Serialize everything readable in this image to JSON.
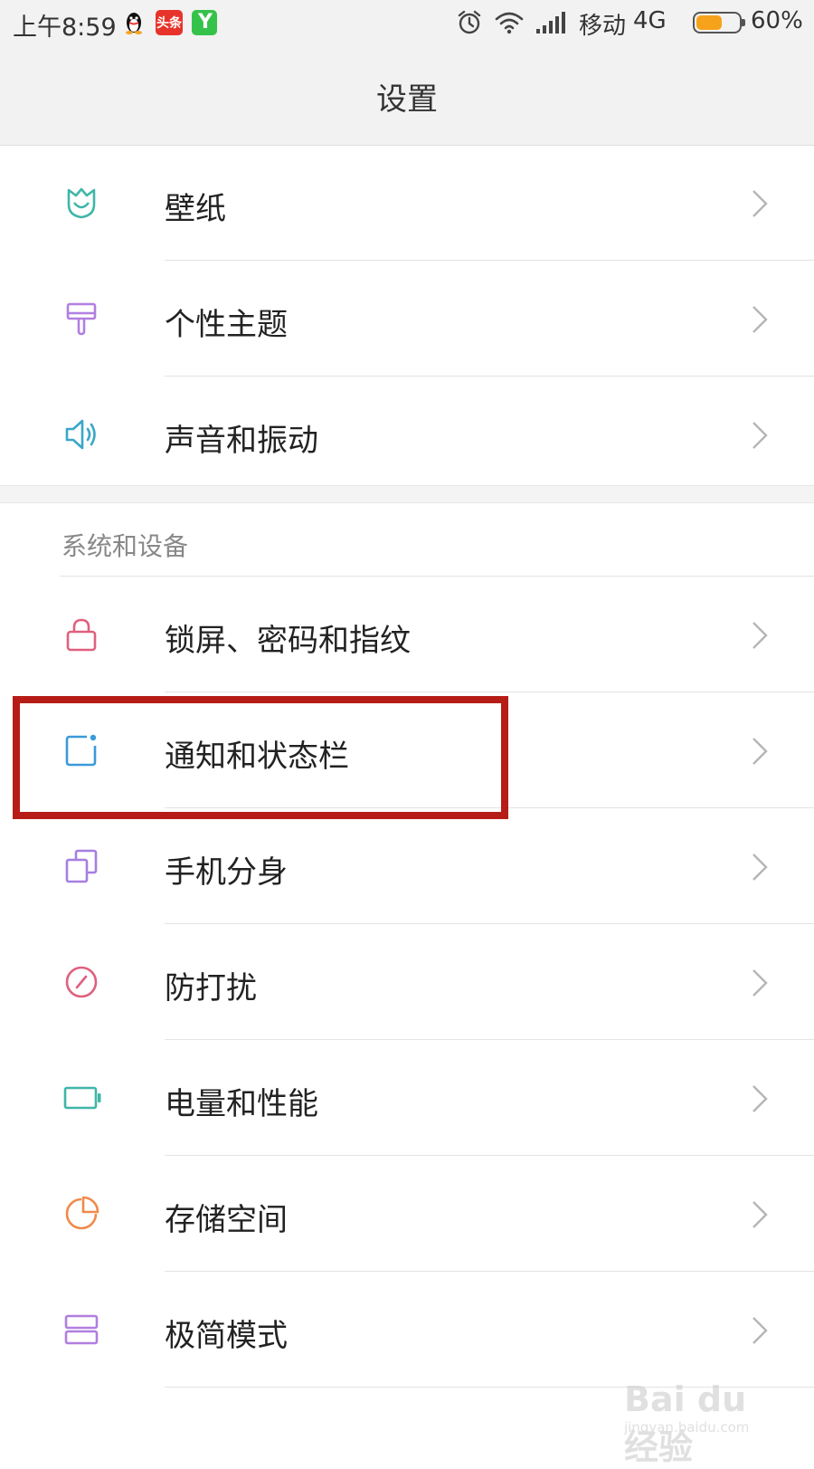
{
  "status_bar": {
    "time": "上午8:59",
    "app_icons": [
      "qq-icon",
      "toutiao-icon",
      "y-app-icon"
    ],
    "toutiao_label": "头条",
    "y_label": "Y",
    "carrier": "移动",
    "network": "4G",
    "battery": "60%",
    "battery_level": 0.6
  },
  "header": {
    "title": "设置"
  },
  "items_top": [
    {
      "label": "壁纸",
      "icon": "wallpaper-icon",
      "color": "#3fb6a8"
    },
    {
      "label": "个性主题",
      "icon": "theme-brush-icon",
      "color": "#b17fe0"
    },
    {
      "label": "声音和振动",
      "icon": "speaker-icon",
      "color": "#3aa6c9"
    }
  ],
  "section": {
    "title": "系统和设备"
  },
  "items_system": [
    {
      "label": "锁屏、密码和指纹",
      "icon": "lock-icon",
      "color": "#e0607e"
    },
    {
      "label": "通知和状态栏",
      "icon": "notification-icon",
      "color": "#3a9ad9"
    },
    {
      "label": "手机分身",
      "icon": "dual-phone-icon",
      "color": "#a67fe0"
    },
    {
      "label": "防打扰",
      "icon": "do-not-disturb-icon",
      "color": "#e0607e"
    },
    {
      "label": "电量和性能",
      "icon": "battery-icon",
      "color": "#3fb6a8"
    },
    {
      "label": "存储空间",
      "icon": "storage-pie-icon",
      "color": "#f08a4b"
    },
    {
      "label": "极简模式",
      "icon": "simple-mode-icon",
      "color": "#b17fe0"
    }
  ],
  "watermark": {
    "brand": "Bai du 经验",
    "url": "jingyan.baidu.com"
  },
  "highlight_color": "#b71d17"
}
